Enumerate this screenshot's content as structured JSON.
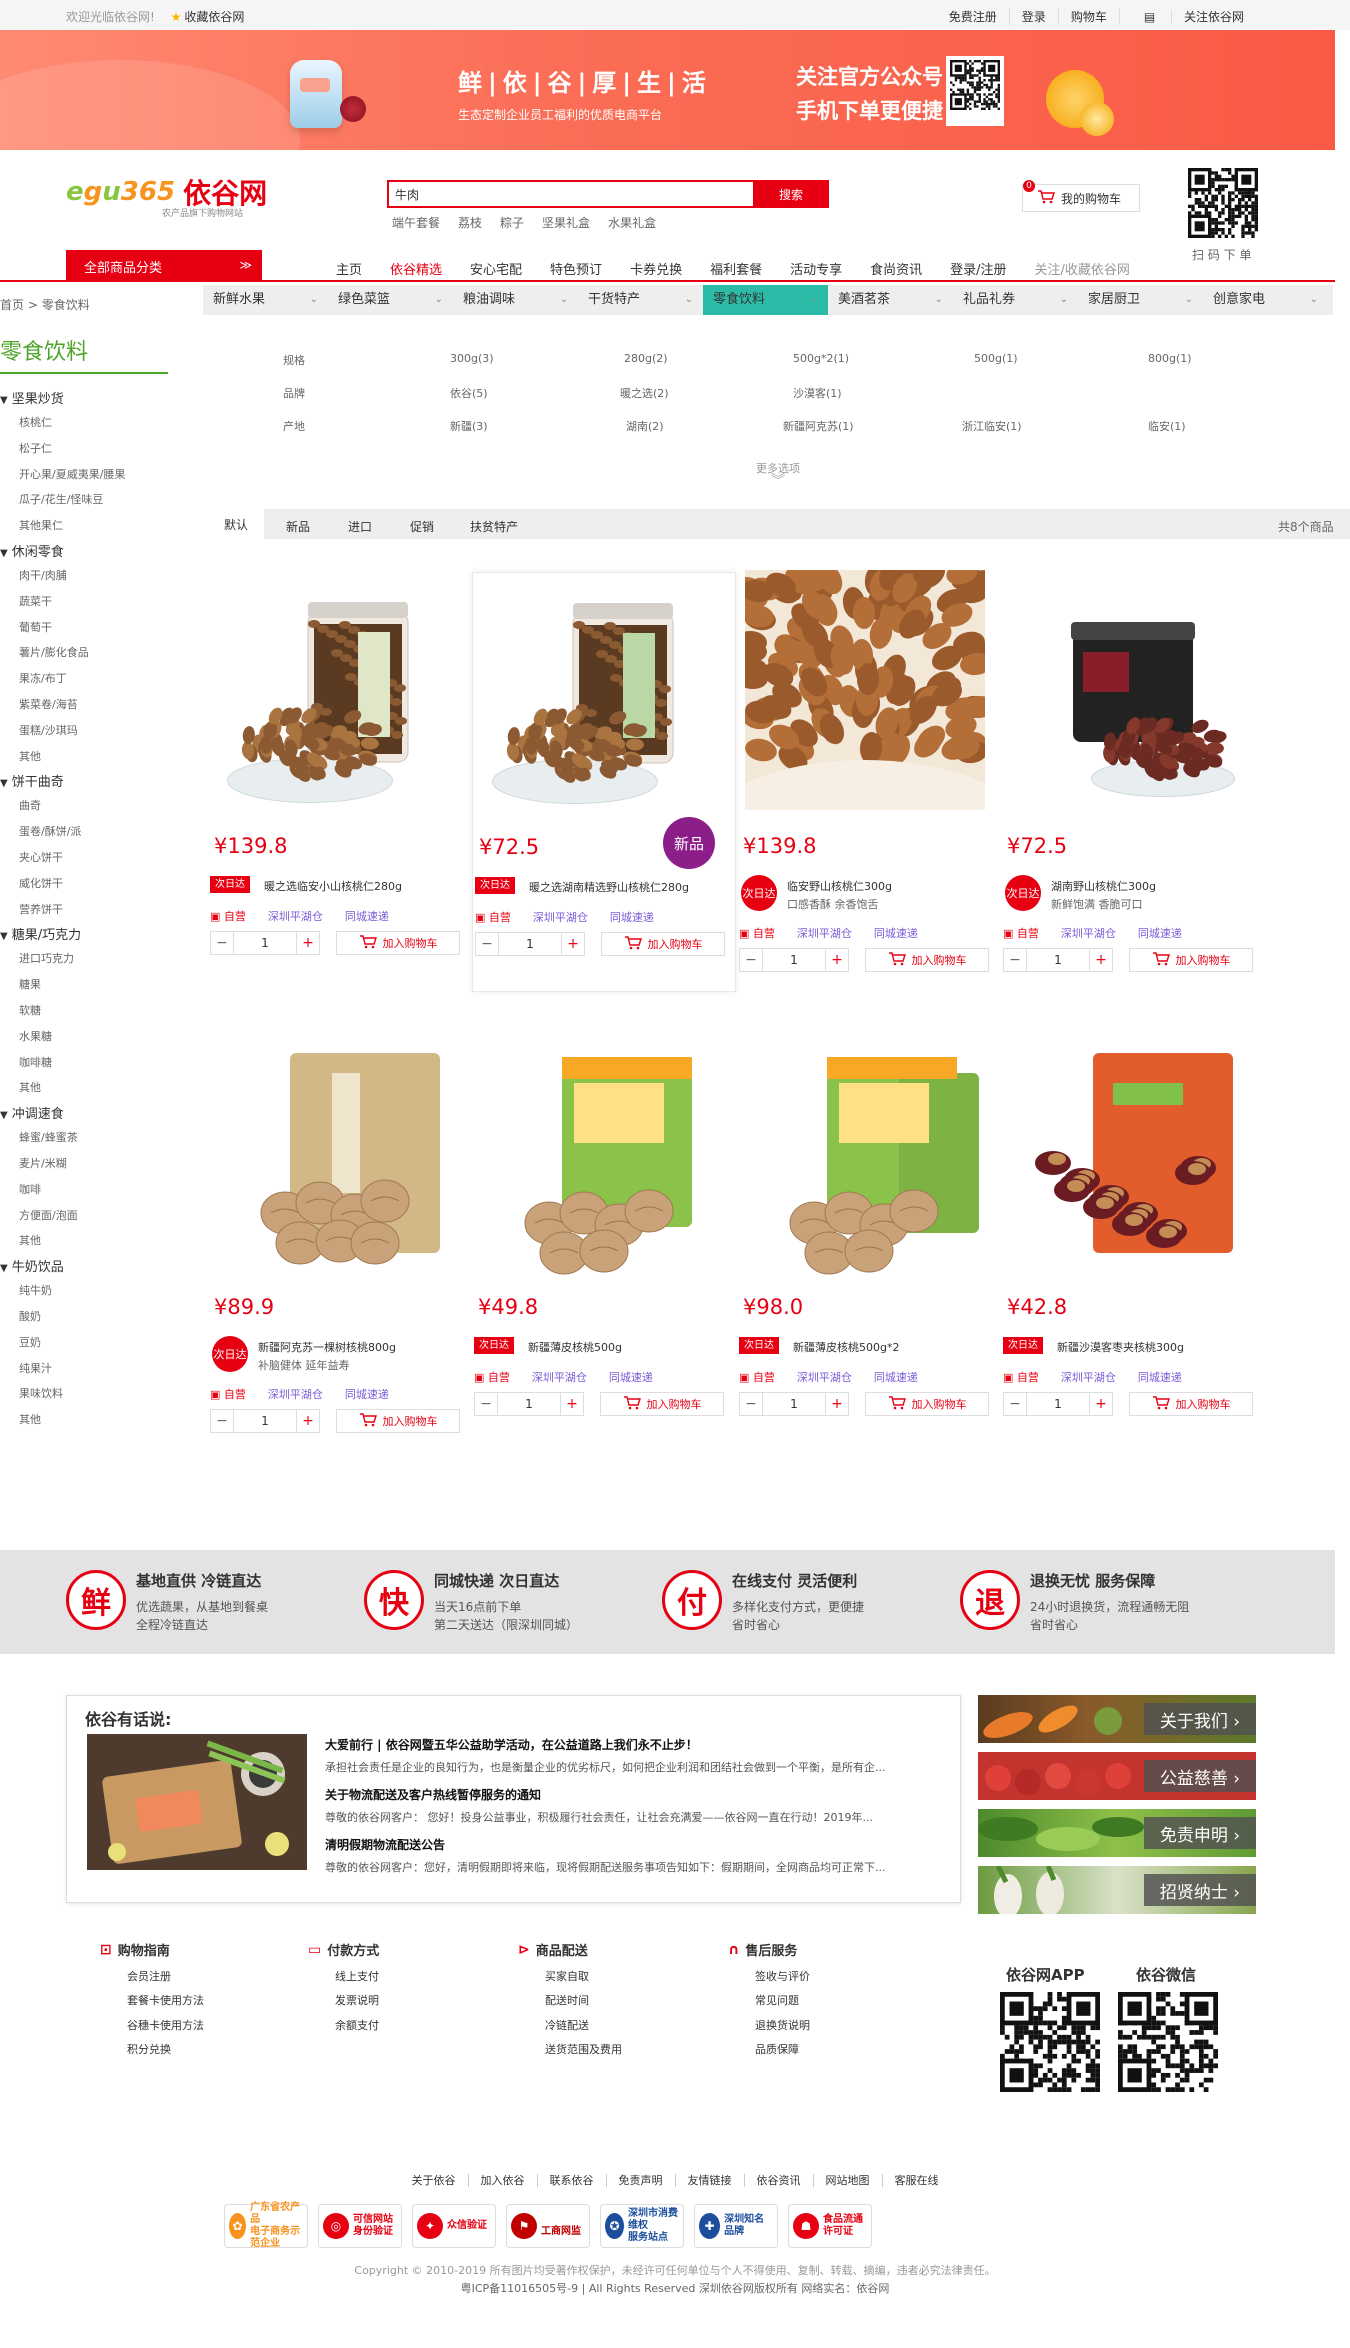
{
  "topbar": {
    "welcome": "欢迎光临依谷网!",
    "favorite": "收藏依谷网",
    "links": [
      "免费注册",
      "登录",
      "购物车",
      "关注依谷网"
    ]
  },
  "banner": {
    "slogan": "鲜|依|谷|厚|生|活",
    "tagline": "生态定制企业员工福利的优质电商平台",
    "follow_line1": "关注官方公众号",
    "follow_line2": "手机下单更便捷"
  },
  "header": {
    "logo_name": "依谷网",
    "logo_sub": "农产品旗下购物网站",
    "search_value": "牛肉",
    "search_button": "搜索",
    "hot_words": [
      "端午套餐",
      "荔枝",
      "粽子",
      "坚果礼盒",
      "水果礼盒"
    ],
    "cart_label": "我的购物车",
    "cart_count": "0",
    "scan_label": "扫 码 下 单"
  },
  "nav": {
    "category_button": "全部商品分类",
    "items": [
      "主页",
      "依谷精选",
      "安心宅配",
      "特色预订",
      "卡券兑换",
      "福利套餐",
      "活动专享",
      "食尚资讯",
      "登录/注册",
      "关注/收藏依谷网"
    ]
  },
  "breadcrumb": [
    "首页",
    "零食饮料"
  ],
  "sidebar": {
    "title": "零食饮料",
    "groups": [
      {
        "name": "坚果炒货",
        "items": [
          "核桃仁",
          "松子仁",
          "开心果/夏威夷果/腰果",
          "瓜子/花生/怪味豆",
          "其他果仁"
        ]
      },
      {
        "name": "休闲零食",
        "items": [
          "肉干/肉脯",
          "蔬菜干",
          "葡萄干",
          "薯片/膨化食品",
          "果冻/布丁",
          "紫菜卷/海苔",
          "蛋糕/沙琪玛",
          "其他"
        ]
      },
      {
        "name": "饼干曲奇",
        "items": [
          "曲奇",
          "蛋卷/酥饼/派",
          "夹心饼干",
          "威化饼干",
          "营养饼干"
        ]
      },
      {
        "name": "糖果/巧克力",
        "items": [
          "进口巧克力",
          "糖果",
          "软糖",
          "水果糖",
          "咖啡糖",
          "其他"
        ]
      },
      {
        "name": "冲调速食",
        "items": [
          "蜂蜜/蜂蜜茶",
          "麦片/米糊",
          "咖啡",
          "方便面/泡面",
          "其他"
        ]
      },
      {
        "name": "牛奶饮品",
        "items": [
          "纯牛奶",
          "酸奶",
          "豆奶",
          "纯果汁",
          "果味饮料",
          "其他"
        ]
      }
    ]
  },
  "tabs": [
    "新鲜水果",
    "绿色菜篮",
    "粮油调味",
    "干货特产",
    "零食饮料",
    "美酒茗茶",
    "礼品礼券",
    "家居厨卫",
    "创意家电"
  ],
  "filters": {
    "rows": [
      {
        "label": "规格",
        "values": [
          "300g(3)",
          "280g(2)",
          "500g*2(1)",
          "500g(1)",
          "800g(1)"
        ]
      },
      {
        "label": "品牌",
        "values": [
          "依谷(5)",
          "暖之选(2)",
          "沙漠客(1)"
        ]
      },
      {
        "label": "产地",
        "values": [
          "新疆(3)",
          "湖南(2)",
          "新疆阿克苏(1)",
          "浙江临安(1)",
          "临安(1)"
        ]
      }
    ],
    "more": "更多选项"
  },
  "sortbar": {
    "options": [
      "默认",
      "新品",
      "进口",
      "促销",
      "扶贫特产"
    ],
    "count": "共8个商品"
  },
  "products": [
    {
      "price": "¥139.8",
      "tag": "次日达",
      "name": "暖之选临安小山核桃仁280g",
      "sub": "",
      "self": "自营",
      "warehouse": "深圳平湖仓",
      "delivery": "同城速递",
      "qty": "1",
      "add": "加入购物车"
    },
    {
      "price": "¥72.5",
      "tag": "次日达",
      "name": "暖之选湖南精选野山核桃仁280g",
      "sub": "",
      "self": "自营",
      "warehouse": "深圳平湖仓",
      "delivery": "同城速递",
      "qty": "1",
      "add": "加入购物车",
      "badge": "新品"
    },
    {
      "price": "¥139.8",
      "tag": "次日达",
      "name": "临安野山核桃仁300g",
      "sub": "口感香酥 余香饱舌",
      "self": "自营",
      "warehouse": "深圳平湖仓",
      "delivery": "同城速递",
      "qty": "1",
      "add": "加入购物车"
    },
    {
      "price": "¥72.5",
      "tag": "次日达",
      "name": "湖南野山核桃仁300g",
      "sub": "新鲜饱满 香脆可口",
      "self": "自营",
      "warehouse": "深圳平湖仓",
      "delivery": "同城速递",
      "qty": "1",
      "add": "加入购物车"
    },
    {
      "price": "¥89.9",
      "tag": "次日达",
      "name": "新疆阿克苏一棵树核桃800g",
      "sub": "补脑健体 延年益寿",
      "self": "自营",
      "warehouse": "深圳平湖仓",
      "delivery": "同城速递",
      "qty": "1",
      "add": "加入购物车"
    },
    {
      "price": "¥49.8",
      "tag": "次日达",
      "name": "新疆薄皮核桃500g",
      "sub": "",
      "self": "自营",
      "warehouse": "深圳平湖仓",
      "delivery": "同城速递",
      "qty": "1",
      "add": "加入购物车"
    },
    {
      "price": "¥98.0",
      "tag": "次日达",
      "name": "新疆薄皮核桃500g*2",
      "sub": "",
      "self": "自营",
      "warehouse": "深圳平湖仓",
      "delivery": "同城速递",
      "qty": "1",
      "add": "加入购物车"
    },
    {
      "price": "¥42.8",
      "tag": "次日达",
      "name": "新疆沙漠客枣夹核桃300g",
      "sub": "",
      "self": "自营",
      "warehouse": "深圳平湖仓",
      "delivery": "同城速递",
      "qty": "1",
      "add": "加入购物车"
    }
  ],
  "services": [
    {
      "char": "鲜",
      "title": "基地直供 冷链直达",
      "line1": "优选蔬果，从基地到餐桌",
      "line2": "全程冷链直达"
    },
    {
      "char": "快",
      "title": "同城快递 次日直达",
      "line1": "当天16点前下单",
      "line2": "第二天送达（限深圳同城）"
    },
    {
      "char": "付",
      "title": "在线支付 灵活便利",
      "line1": "多样化支付方式，更便捷",
      "line2": "省时省心"
    },
    {
      "char": "退",
      "title": "退换无忧 服务保障",
      "line1": "24小时退换货，流程通畅无阻",
      "line2": "省时省心"
    }
  ],
  "news": {
    "title": "依谷有话说:",
    "items": [
      {
        "head": "大爱前行 | 依谷网暨五华公益助学活动，在公益道路上我们永不止步！",
        "body": "承担社会责任是企业的良知行为，也是衡量企业的优劣标尺，如何把企业利润和团结社会做到一个平衡，是所有企..."
      },
      {
        "head": "关于物流配送及客户热线暂停服务的通知",
        "body": "尊敬的依谷网客户： 您好！投身公益事业，积极履行社会责任，让社会充满爱——依谷网一直在行动！2019年..."
      },
      {
        "head": "清明假期物流配送公告",
        "body": "尊敬的依谷网客户：您好，清明假期即将来临，现将假期配送服务事项告知如下：假期期间，全网商品均可正常下..."
      }
    ]
  },
  "panels": [
    "关于我们 ›",
    "公益慈善 ›",
    "免责申明 ›",
    "招贤纳士 ›"
  ],
  "help": [
    {
      "title": "购物指南",
      "icon": "cart-icon",
      "items": [
        "会员注册",
        "套餐卡使用方法",
        "谷穗卡使用方法",
        "积分兑换"
      ]
    },
    {
      "title": "付款方式",
      "icon": "card-icon",
      "items": [
        "线上支付",
        "发票说明",
        "余额支付"
      ]
    },
    {
      "title": "商品配送",
      "icon": "truck-icon",
      "items": [
        "买家自取",
        "配送时间",
        "冷链配送",
        "送货范围及费用"
      ]
    },
    {
      "title": "售后服务",
      "icon": "headset-icon",
      "items": [
        "签收与评价",
        "常见问题",
        "退换货说明",
        "品质保障"
      ]
    }
  ],
  "app_label": "依谷网APP",
  "wechat_label": "依谷微信",
  "footer_links": [
    "关于依谷",
    "加入依谷",
    "联系依谷",
    "免责声明",
    "友情链接",
    "依谷资讯",
    "网站地图",
    "客服在线"
  ],
  "cert_badges": [
    {
      "line1": "广东省农产品",
      "line2": "电子商务示范企业",
      "color": "#f7931e"
    },
    {
      "line1": "可信网站",
      "line2": "身份验证",
      "color": "#e60012"
    },
    {
      "line1": "众信验证",
      "line2": "",
      "color": "#e60012"
    },
    {
      "line1": "",
      "line2": "工商网监",
      "color": "#c00000"
    },
    {
      "line1": "深圳市消费维权",
      "line2": "服务站点",
      "color": "#1d4e9e"
    },
    {
      "line1": "深圳知名品牌",
      "line2": "",
      "color": "#1d4e9e"
    },
    {
      "line1": "食品流通",
      "line2": "许可证",
      "color": "#e60012"
    }
  ],
  "copyright": {
    "line1": "Copyright © 2010-2019 所有图片均受著作权保护，未经许可任何单位与个人不得使用、复制、转载、摘编，违者必究法律责任。",
    "line2": "粤ICP备11016505号-9 | All Rights Reserved 深圳依谷网版权所有 网络实名：依谷网"
  }
}
